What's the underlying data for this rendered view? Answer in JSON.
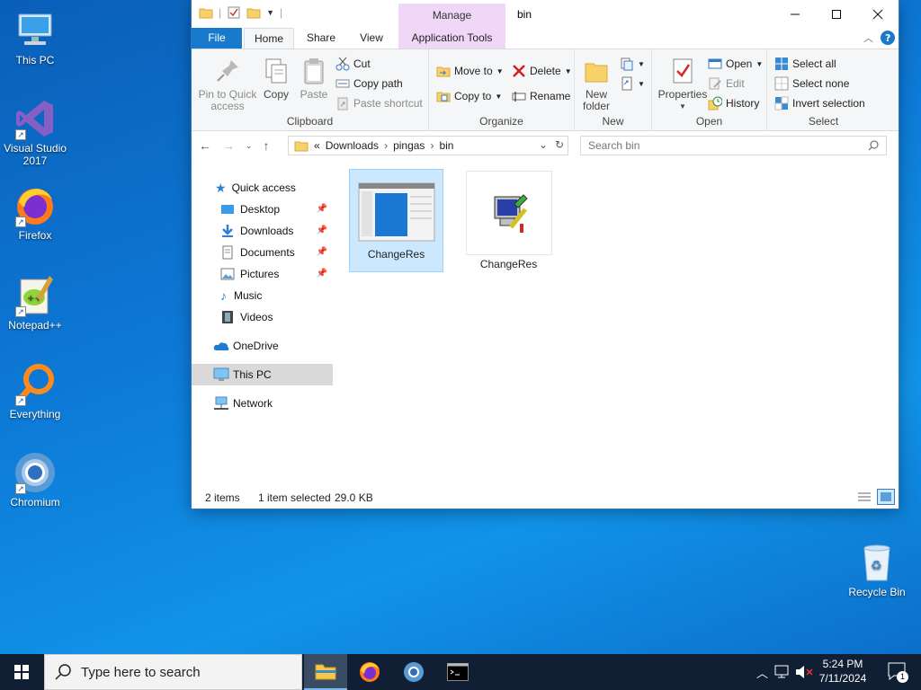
{
  "desktop": {
    "icons": [
      {
        "label": "This PC"
      },
      {
        "label": "Visual Studio 2017"
      },
      {
        "label": "Firefox"
      },
      {
        "label": "Notepad++"
      },
      {
        "label": "Everything"
      },
      {
        "label": "Chromium"
      },
      {
        "label": "Recycle Bin"
      }
    ]
  },
  "window": {
    "title": "bin",
    "manage_tab": "Manage",
    "tabs": {
      "file": "File",
      "home": "Home",
      "share": "Share",
      "view": "View",
      "app_tools": "Application Tools"
    },
    "ribbon": {
      "clipboard": {
        "label": "Clipboard",
        "pin": "Pin to Quick access",
        "copy": "Copy",
        "paste": "Paste",
        "cut": "Cut",
        "copy_path": "Copy path",
        "paste_shortcut": "Paste shortcut"
      },
      "organize": {
        "label": "Organize",
        "move_to": "Move to",
        "copy_to": "Copy to",
        "delete": "Delete",
        "rename": "Rename"
      },
      "new": {
        "label": "New",
        "new_folder": "New folder"
      },
      "open": {
        "label": "Open",
        "properties": "Properties",
        "open": "Open",
        "edit": "Edit",
        "history": "History"
      },
      "select": {
        "label": "Select",
        "select_all": "Select all",
        "select_none": "Select none",
        "invert": "Invert selection"
      }
    },
    "address": {
      "crumbs": [
        "Downloads",
        "pingas",
        "bin"
      ],
      "overflow": "«"
    },
    "search_placeholder": "Search bin",
    "nav": {
      "quick_access": "Quick access",
      "desktop": "Desktop",
      "downloads": "Downloads",
      "documents": "Documents",
      "pictures": "Pictures",
      "music": "Music",
      "videos": "Videos",
      "onedrive": "OneDrive",
      "this_pc": "This PC",
      "network": "Network"
    },
    "files": [
      {
        "name": "ChangeRes",
        "selected": true
      },
      {
        "name": "ChangeRes",
        "selected": false
      }
    ],
    "status": {
      "count": "2 items",
      "selection": "1 item selected",
      "size": "29.0 KB"
    }
  },
  "taskbar": {
    "search_placeholder": "Type here to search",
    "time": "5:24 PM",
    "date": "7/11/2024",
    "notifications": "1"
  }
}
